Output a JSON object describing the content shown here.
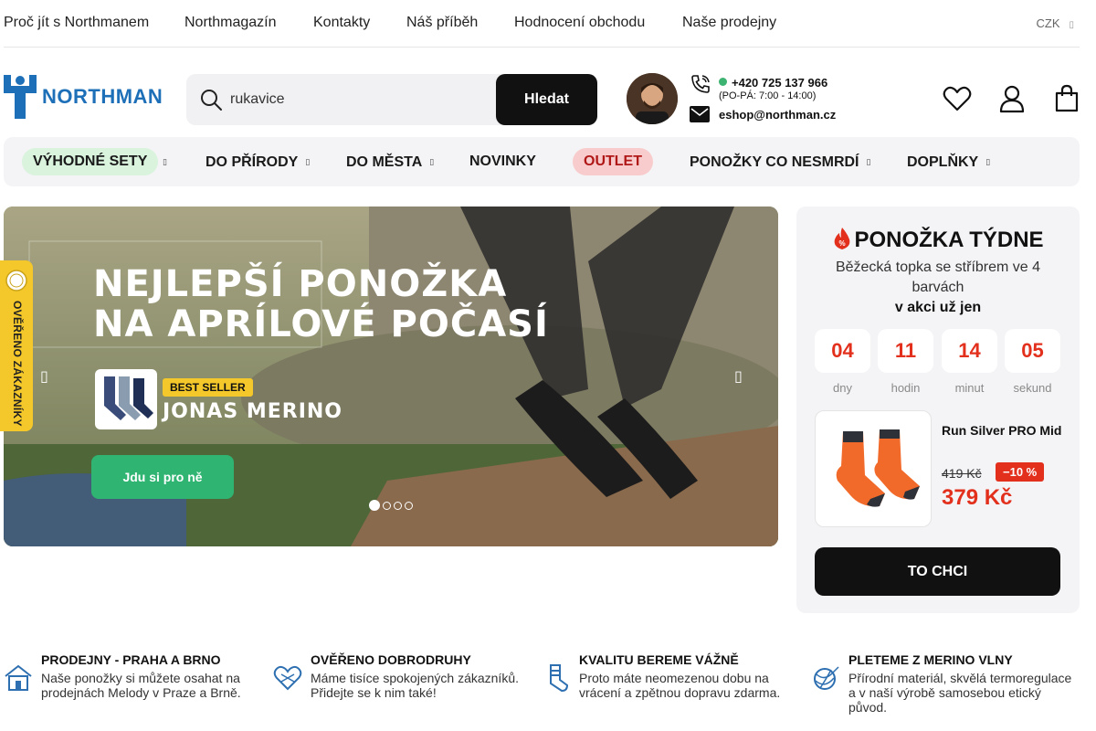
{
  "top_links": {
    "items": [
      {
        "label": "Proč jít s Northmanem"
      },
      {
        "label": "Northmagazín"
      },
      {
        "label": "Kontakty"
      },
      {
        "label": "Náš příběh"
      },
      {
        "label": "Hodnocení obchodu"
      },
      {
        "label": "Naše prodejny"
      }
    ],
    "currency": "CZK"
  },
  "header": {
    "logo_text": "NORTHMAN",
    "search": {
      "value": "rukavice",
      "button": "Hledat"
    },
    "phone": "+420 725 137 966",
    "hours": "(PO-PÁ: 7:00 - 14:00)",
    "email": "eshop@northman.cz",
    "icons": [
      "heart-icon",
      "user-icon",
      "cart-icon"
    ],
    "accent_color": "#1d6fb8"
  },
  "nav": {
    "items": [
      {
        "label": "VÝHODNÉ SETY"
      },
      {
        "label": "DO PŘÍRODY"
      },
      {
        "label": "DO MĚSTA"
      },
      {
        "label": "NOVINKY"
      },
      {
        "label": "OUTLET"
      },
      {
        "label": "PONOŽKY CO NESMRDÍ"
      },
      {
        "label": "DOPLŇKY"
      }
    ]
  },
  "banner": {
    "headline_1": "NEJLEPŠÍ PONOŽKA",
    "headline_2": "NA APRÍLOVÉ POČASÍ",
    "badge": "BEST SELLER",
    "product": "JONAS MERINO",
    "cta": "Jdu si pro ně",
    "slides": 4,
    "active_slide": 1
  },
  "side_badge": "OVĚŘENO ZÁKAZNÍKY",
  "sock_of_week": {
    "title": "PONOŽKA TÝDNE",
    "subtitle": "Běžecká topka se stříbrem ve 4 barvách",
    "promo": "v akci už jen",
    "countdown": [
      {
        "value": "04",
        "label": "dny"
      },
      {
        "value": "11",
        "label": "hodin"
      },
      {
        "value": "14",
        "label": "minut"
      },
      {
        "value": "05",
        "label": "sekund"
      }
    ],
    "product_name": "Run Silver PRO Mid",
    "old_price": "419 Kč",
    "discount": "−10 %",
    "new_price": "379 Kč",
    "cta": "TO CHCI",
    "sale_color": "#e2301d"
  },
  "features": [
    {
      "icon": "store-icon",
      "title": "PRODEJNY - PRAHA A BRNO",
      "text": "Naše ponožky si můžete osahat na prodejnách Melody v Praze a Brně."
    },
    {
      "icon": "heart-icon",
      "title": "OVĚŘENO DOBRODRUHY",
      "text": "Máme tisíce spokojených zákazníků. Přidejte se k nim také!"
    },
    {
      "icon": "sock-icon",
      "title": "KVALITU BEREME VÁŽNĚ",
      "text": "Proto máte neomezenou dobu na vrácení a zpětnou dopravu zdarma."
    },
    {
      "icon": "yarn-icon",
      "title": "PLETEME Z MERINO VLNY",
      "text": "Přírodní materiál, skvělá termoregulace a v naší výrobě samosebou etický původ."
    }
  ]
}
